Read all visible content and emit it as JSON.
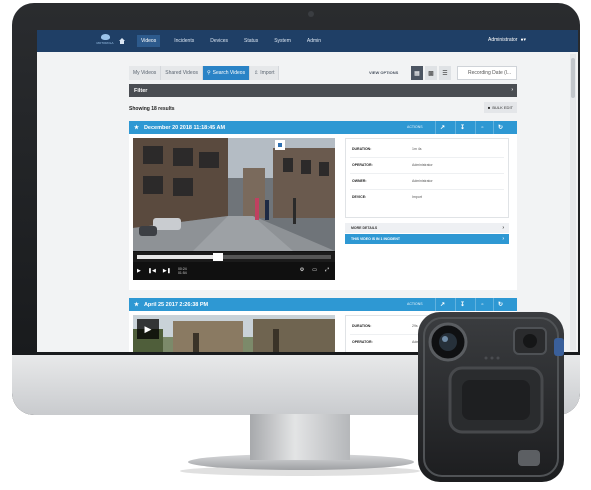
{
  "navbar": {
    "logo_text": "MOTOROLA",
    "items": [
      "Videos",
      "Incidents",
      "Devices",
      "Status",
      "System",
      "Admin"
    ],
    "active_index": 0,
    "user": "Administrator"
  },
  "toolbar": {
    "tabs": [
      "My Videos",
      "Shared Videos",
      "Search Videos",
      "Import"
    ],
    "active_tab": 2,
    "view_options_label": "VIEW OPTIONS",
    "sort_label": "Recording Date (l..."
  },
  "filter": {
    "label": "Filter"
  },
  "results": {
    "label": "Showing 18 results",
    "bulk_edit_label": "BULK EDIT"
  },
  "cards": [
    {
      "title": "December 20 2018 11:18:45 AM",
      "actions_label": "ACTIONS",
      "player": {
        "current_time": "00:24",
        "total_time": "01:54",
        "progress": 0.42
      },
      "details": [
        {
          "key": "DURATION:",
          "value": "1m 4s"
        },
        {
          "key": "OPERATOR:",
          "value": "Administrator"
        },
        {
          "key": "OWNER:",
          "value": "Administrator"
        },
        {
          "key": "DEVICE:",
          "value": "Import"
        }
      ],
      "more_details_label": "MORE DETAILS",
      "incident_label": "THIS VIDEO IS IN 1 INCIDENT"
    },
    {
      "title": "April 25 2017 2:26:38 PM",
      "actions_label": "ACTIONS",
      "details": [
        {
          "key": "DURATION:",
          "value": "29s"
        },
        {
          "key": "OPERATOR:",
          "value": "Administrator"
        }
      ]
    }
  ],
  "colors": {
    "navbar": "#1f3f66",
    "accent": "#2e98d3",
    "filter_bar": "#4a4d52",
    "monitor_bezel": "#1c1e21",
    "monitor_chin": "#d9dadc"
  }
}
